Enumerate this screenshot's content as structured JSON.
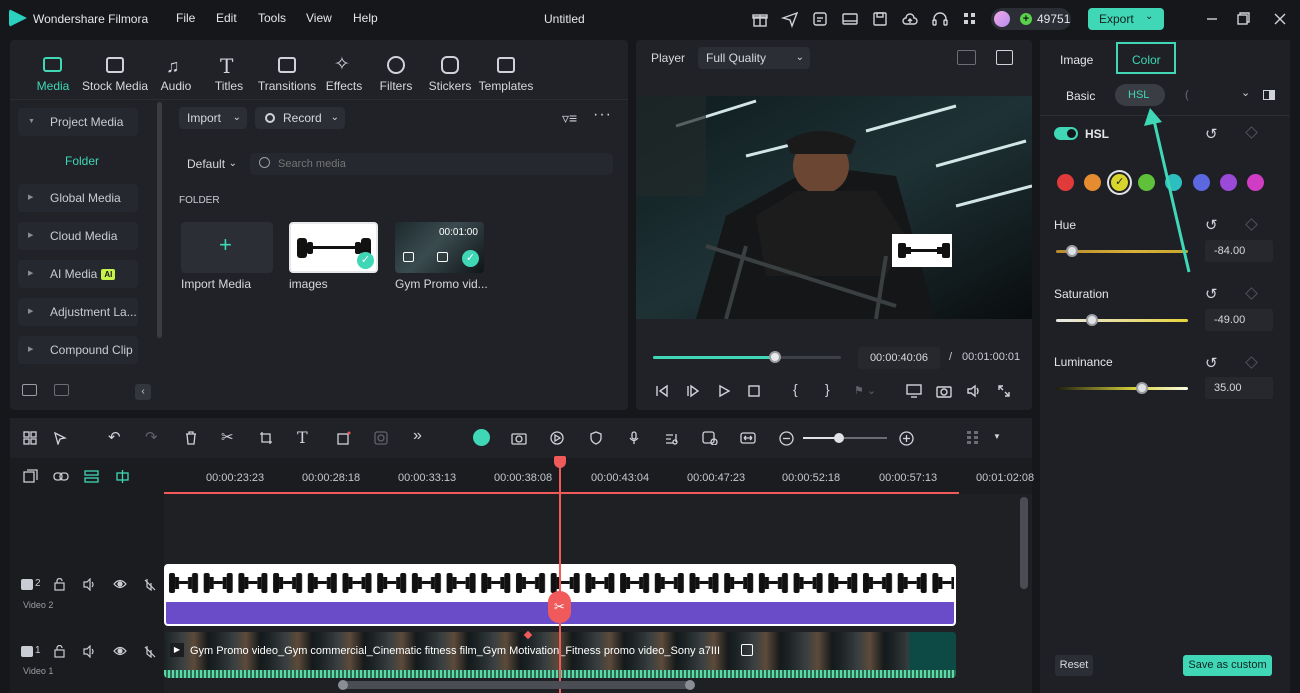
{
  "app": {
    "name": "Wondershare Filmora",
    "doc_title": "Untitled",
    "credits": "49751",
    "export_label": "Export"
  },
  "menu": [
    "File",
    "Edit",
    "Tools",
    "View",
    "Help"
  ],
  "toolbar_tabs": [
    {
      "label": "Media",
      "icon": "media-icon"
    },
    {
      "label": "Stock Media",
      "icon": "stock-media-icon"
    },
    {
      "label": "Audio",
      "icon": "audio-icon"
    },
    {
      "label": "Titles",
      "icon": "titles-icon"
    },
    {
      "label": "Transitions",
      "icon": "transitions-icon"
    },
    {
      "label": "Effects",
      "icon": "effects-icon"
    },
    {
      "label": "Filters",
      "icon": "filters-icon"
    },
    {
      "label": "Stickers",
      "icon": "stickers-icon"
    },
    {
      "label": "Templates",
      "icon": "templates-icon"
    }
  ],
  "sidebar": {
    "items": [
      "Project Media",
      "Folder",
      "Global Media",
      "Cloud Media",
      "AI Media",
      "Adjustment La...",
      "Compound Clip"
    ],
    "ai_badge": "AI"
  },
  "media": {
    "import_label": "Import",
    "record_label": "Record",
    "sort_label": "Default",
    "search_placeholder": "Search media",
    "folder_heading": "FOLDER",
    "items": [
      {
        "label": "Import Media"
      },
      {
        "label": "images"
      },
      {
        "label": "Gym Promo vid...",
        "duration": "00:01:00"
      }
    ]
  },
  "player": {
    "label": "Player",
    "quality": "Full Quality",
    "current_time": "00:00:40:06",
    "separator": "/",
    "total_time": "00:01:00:01",
    "progress": 0.65
  },
  "timeline": {
    "ruler": [
      "00:00:23:23",
      "00:00:28:18",
      "00:00:33:13",
      "00:00:38:08",
      "00:00:43:04",
      "00:00:47:23",
      "00:00:52:18",
      "00:00:57:13",
      "00:01:02:08"
    ],
    "tracks": [
      {
        "number": "2",
        "name": "Video 2"
      },
      {
        "number": "1",
        "name": "Video 1"
      }
    ],
    "clip_label": "Gym Promo video_Gym commercial_Cinematic fitness film_Gym Motivation_Fitness promo video_Sony a7III",
    "zoom": 0.43
  },
  "color_panel": {
    "tabs": [
      "Image",
      "Color"
    ],
    "subtabs": [
      "Basic",
      "HSL"
    ],
    "hsl_label": "HSL",
    "hsl_enabled": true,
    "swatches": [
      "#e03a3a",
      "#e58c30",
      "#d9d42c",
      "#5fc13a",
      "#2dbfbf",
      "#5b68e0",
      "#9b49d8",
      "#d13cc4"
    ],
    "hue": {
      "label": "Hue",
      "value": "-84.00"
    },
    "saturation": {
      "label": "Saturation",
      "value": "-49.00"
    },
    "luminance": {
      "label": "Luminance",
      "value": "35.00"
    },
    "reset_label": "Reset",
    "save_label": "Save as custom"
  },
  "colors": {
    "accent": "#3fd7b6",
    "playhead": "#f05a5a",
    "clip_purple": "#6a4cc8"
  }
}
